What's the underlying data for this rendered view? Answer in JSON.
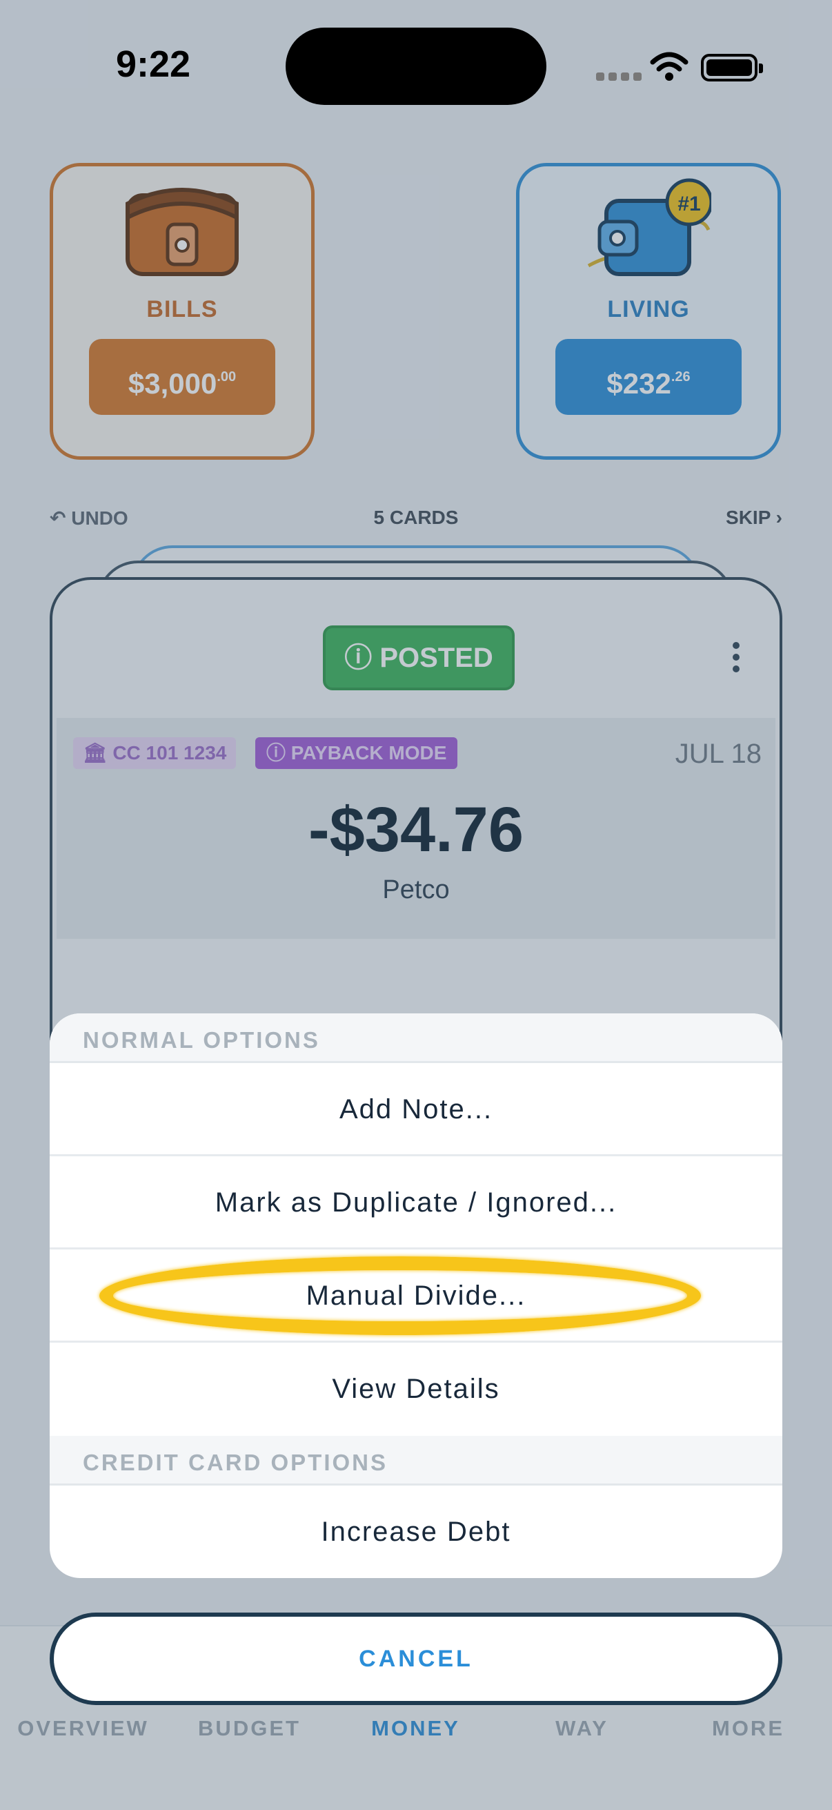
{
  "status_bar": {
    "time": "9:22"
  },
  "envelopes": [
    {
      "name": "BILLS",
      "amount_main": "$3,000",
      "amount_cents": ".00",
      "color": "#d4782c"
    },
    {
      "name": "LIVING",
      "amount_main": "$232",
      "amount_cents": ".26",
      "badge": "#1",
      "color": "#2b8ed8"
    }
  ],
  "deck": {
    "undo_label": "UNDO",
    "count_label": "5 CARDS",
    "skip_label": "SKIP"
  },
  "transaction": {
    "status": "POSTED",
    "account": "CC 101 1234",
    "mode": "PAYBACK MODE",
    "date": "JUL 18",
    "amount": "-$34.76",
    "merchant": "Petco"
  },
  "action_sheet": {
    "sections": [
      {
        "header": "NORMAL OPTIONS",
        "options": [
          "Add Note...",
          "Mark as Duplicate / Ignored...",
          "Manual Divide...",
          "View Details"
        ]
      },
      {
        "header": "CREDIT CARD OPTIONS",
        "options": [
          "Increase Debt"
        ]
      }
    ],
    "highlighted_option": "Manual Divide...",
    "highlight_color": "#f7c51a",
    "cancel_label": "CANCEL"
  },
  "tabs": [
    {
      "label": "OVERVIEW",
      "active": false
    },
    {
      "label": "BUDGET",
      "active": false
    },
    {
      "label": "MONEY",
      "active": true
    },
    {
      "label": "WAY",
      "active": false
    },
    {
      "label": "MORE",
      "active": false
    }
  ],
  "colors": {
    "accent": "#2b8ed8",
    "posted_green": "#3cb35a",
    "payback_purple": "#a05cd6"
  }
}
